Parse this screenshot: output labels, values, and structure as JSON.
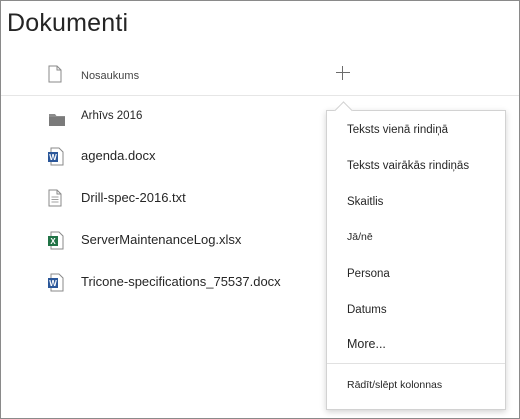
{
  "page": {
    "title": "Dokumenti"
  },
  "header": {
    "name_column_label": "Nosaukums",
    "add_column_icon": "plus-icon"
  },
  "files": [
    {
      "name": "Arhīvs 2016",
      "icon": "folder-icon",
      "type": "folder"
    },
    {
      "name": "agenda.docx",
      "icon": "word-document-icon",
      "type": "word"
    },
    {
      "name": "Drill-spec-2016.txt",
      "icon": "text-file-icon",
      "type": "text"
    },
    {
      "name": "ServerMaintenanceLog.xlsx",
      "icon": "excel-workbook-icon",
      "type": "excel"
    },
    {
      "name": "Tricone-specifications_75537.docx",
      "icon": "word-document-icon",
      "type": "word"
    }
  ],
  "column_menu": {
    "items": [
      {
        "label": "Teksts vienā rindiņā"
      },
      {
        "label": "Teksts vairākās rindiņās"
      },
      {
        "label": "Skaitlis"
      },
      {
        "label": "Jā/nē"
      },
      {
        "label": "Persona"
      },
      {
        "label": "Datums"
      },
      {
        "label": "More..."
      }
    ],
    "footer_item": {
      "label": "Rādīt/slēpt kolonnas"
    }
  },
  "colors": {
    "word": "#2b579a",
    "excel": "#217346",
    "folder": "#8c8c8c",
    "border": "#8a8a8a"
  }
}
